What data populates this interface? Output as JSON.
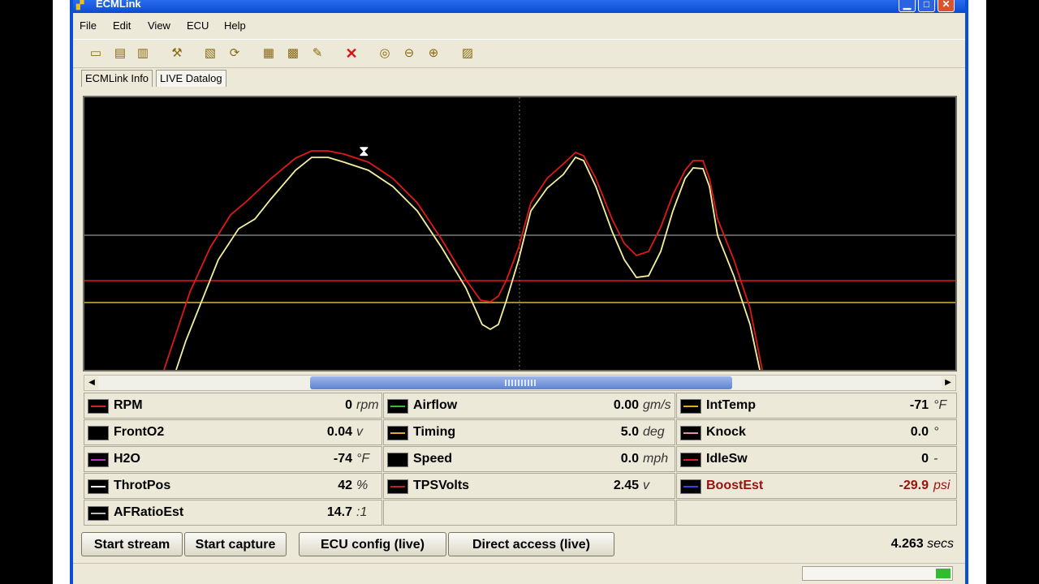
{
  "window": {
    "title": "ECMLink"
  },
  "menu": [
    "File",
    "Edit",
    "View",
    "ECU",
    "Help"
  ],
  "toolbar": [
    "open-folder-icon",
    "save-icon",
    "save-all-icon",
    "tools-icon",
    "load-map-icon",
    "refresh-icon",
    "map-edit-icon",
    "map-grid-icon",
    "tune-tools-icon",
    "delete-icon",
    "zoom-actual-icon",
    "zoom-out-icon",
    "zoom-in-icon",
    "chart-icon"
  ],
  "tabs": [
    {
      "label": "ECMLink Info"
    },
    {
      "label": "LIVE Datalog"
    }
  ],
  "channels": [
    {
      "name": "RPM",
      "value": "0",
      "unit": "rpm",
      "color": "#e02020"
    },
    {
      "name": "FrontO2",
      "value": "0.04",
      "unit": "v",
      "color": "#000000"
    },
    {
      "name": "H2O",
      "value": "-74",
      "unit": "°F",
      "color": "#c030c0"
    },
    {
      "name": "ThrotPos",
      "value": "42",
      "unit": "%",
      "color": "#ffffff"
    },
    {
      "name": "AFRatioEst",
      "value": "14.7",
      "unit": ":1",
      "color": "#bbbbbb"
    },
    {
      "name": "Airflow",
      "value": "0.00",
      "unit": "gm/s",
      "color": "#30c030"
    },
    {
      "name": "Timing",
      "value": "5.0",
      "unit": "deg",
      "color": "#e0b020"
    },
    {
      "name": "Speed",
      "value": "0.0",
      "unit": "mph",
      "color": "#000000"
    },
    {
      "name": "TPSVolts",
      "value": "2.45",
      "unit": "v",
      "color": "#c02020"
    },
    {
      "name": "IntTemp",
      "value": "-71",
      "unit": "°F",
      "color": "#e0b020"
    },
    {
      "name": "Knock",
      "value": "0.0",
      "unit": "°",
      "color": "#e090b0"
    },
    {
      "name": "IdleSw",
      "value": "0",
      "unit": "-",
      "color": "#e02020"
    },
    {
      "name": "BoostEst",
      "value": "-29.9",
      "unit": "psi",
      "color": "#4040e0"
    }
  ],
  "buttons": {
    "start_stream": "Start stream",
    "start_capture": "Start capture",
    "ecu_config": "ECU config (live)",
    "direct_access": "Direct access (live)"
  },
  "status": {
    "time_value": "4.263",
    "time_unit": "secs",
    "progress": 0.1
  },
  "graph_colors": {
    "red": "#e01818",
    "yellow": "#f4f0a0",
    "gray": "#b8b8b8",
    "gold": "#d8b838"
  }
}
